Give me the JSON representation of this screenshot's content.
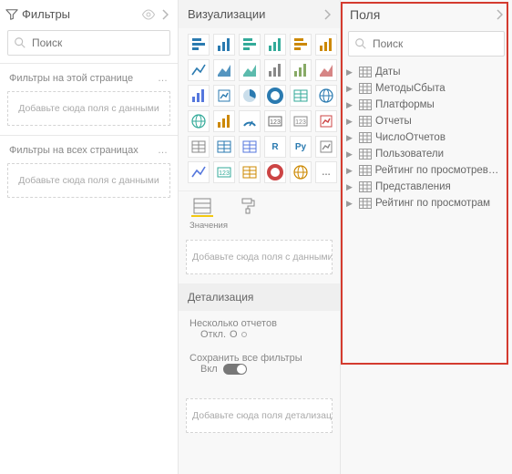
{
  "filters": {
    "title": "Фильтры",
    "search_placeholder": "Поиск",
    "section_page": "Фильтры на этой странице",
    "section_all": "Фильтры на всех страницах",
    "drop_hint": "Добавьте сюда поля с данными"
  },
  "visualizations": {
    "title": "Визуализации",
    "values_caption": "Значения",
    "drop_hint": "Добавьте сюда поля с данными",
    "detail_title": "Детализация",
    "cross_report": "Несколько отчетов",
    "off_label_short": "Откл.",
    "off_indicator": "O",
    "keep_filters": "Сохранить все фильтры",
    "on_label_short": "Вкл",
    "drill_drop_hint": "Добавьте сюда поля детализации",
    "icons": [
      "stacked-bar",
      "stacked-column",
      "clustered-bar",
      "clustered-column",
      "hundred-bar",
      "hundred-column",
      "line",
      "area",
      "stacked-area",
      "line-column",
      "line-clustered",
      "ribbon",
      "waterfall",
      "scatter",
      "pie",
      "donut",
      "treemap",
      "map",
      "filled-map",
      "funnel",
      "gauge",
      "card",
      "multi-card",
      "kpi",
      "slicer",
      "table",
      "matrix",
      "r-visual",
      "py-visual",
      "key-influencers",
      "decomposition",
      "qa",
      "paginated",
      "power-apps",
      "arcgis",
      "custom"
    ],
    "icon_labels": {
      "r-visual": "R",
      "py-visual": "Py",
      "custom": "…"
    }
  },
  "fields": {
    "title": "Поля",
    "search_placeholder": "Поиск",
    "tables": [
      "Даты",
      "МетодыСбыта",
      "Платформы",
      "Отчеты",
      "ЧислоОтчетов",
      "Пользователи",
      "Рейтинг по просмотревшим",
      "Представления",
      "Рейтинг по просмотрам"
    ]
  }
}
